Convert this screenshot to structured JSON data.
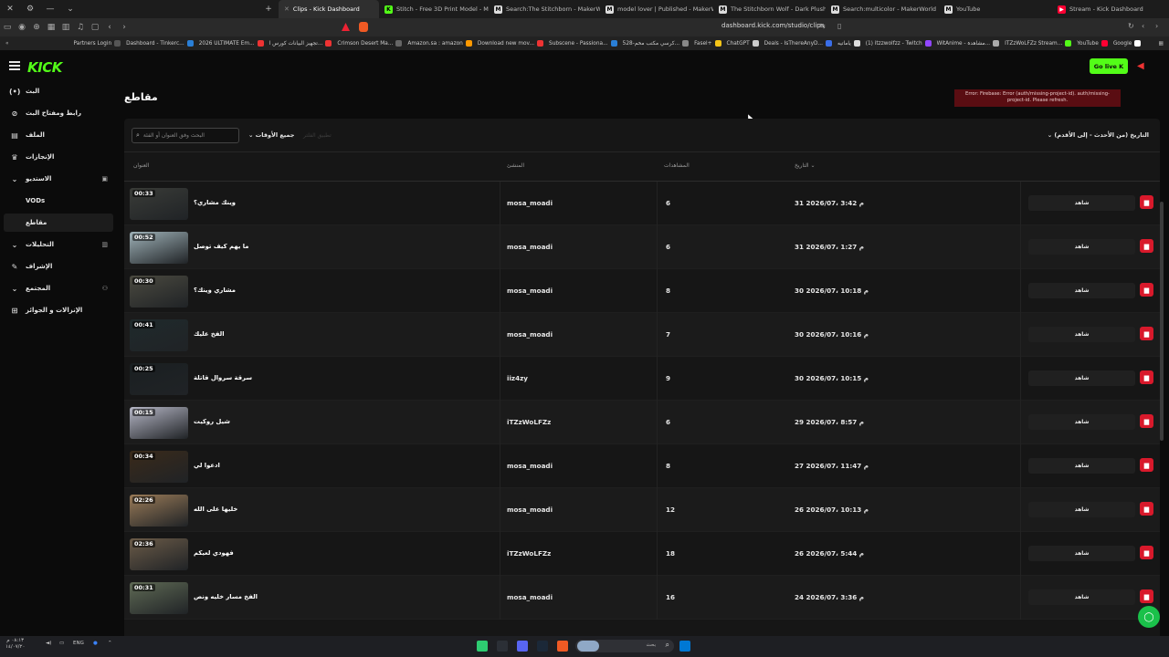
{
  "browser": {
    "tabs": [
      {
        "label": "Clips - Kick Dashboard",
        "icon": "kick-icon",
        "color": "#53fc18",
        "active": true
      },
      {
        "label": "Stitch - Free 3D Print Model - Maker",
        "icon": "makerworld-icon",
        "color": "#e6e6e6"
      },
      {
        "label": "Search:The Stitchborn - MakerWorld",
        "icon": "makerworld-icon",
        "color": "#e6e6e6"
      },
      {
        "label": "model lover | Published - MakerWorld",
        "icon": "makerworld-icon",
        "color": "#e6e6e6"
      },
      {
        "label": "The Stitchborn Wolf - Dark Plush Gu",
        "icon": "makerworld-icon",
        "color": "#e6e6e6"
      },
      {
        "label": "Search:multicolor - MakerWorld",
        "icon": "makerworld-icon",
        "color": "#e6e6e6"
      },
      {
        "label": "YouTube",
        "icon": "youtube-icon",
        "color": "#ff0033"
      },
      {
        "label": "Stream - Kick Dashboard",
        "icon": "kick-icon",
        "color": "#53fc18"
      }
    ],
    "url": "dashboard.kick.com/studio/clips",
    "bookmarks": [
      {
        "label": "Partners Login"
      },
      {
        "label": "Dashboard - Tinkerc..."
      },
      {
        "label": "2026 ULTIMATE Em..."
      },
      {
        "label": "تجهيز البيانات كورس ا..."
      },
      {
        "label": "Crimson Desert Ma..."
      },
      {
        "label": "Amazon.sa : amazon"
      },
      {
        "label": "Download new mov..."
      },
      {
        "label": "Subscene - Passiona..."
      },
      {
        "label": "528-كرسي مكتب مخم..."
      },
      {
        "label": "Fasel+"
      },
      {
        "label": "ChatGPT"
      },
      {
        "label": "Deals - IsThereAnyD..."
      },
      {
        "label": "ياماتيه"
      },
      {
        "label": "(1) itzzwolfzz - Twitch"
      },
      {
        "label": "WitAnime - مشاهدة..."
      },
      {
        "label": "ITZzWoLFZz Stream..."
      },
      {
        "label": "YouTube"
      },
      {
        "label": "Google"
      }
    ]
  },
  "header": {
    "logo": "KICK",
    "go_live": "Go live"
  },
  "sidebar": {
    "items": [
      {
        "label": "البث",
        "icon": "(•)"
      },
      {
        "label": "رابط ومفتاح البث",
        "icon": "🔗"
      },
      {
        "label": "الملف",
        "icon": "▤"
      },
      {
        "label": "الإنجازات",
        "icon": "🏆"
      },
      {
        "label": "الاستديو",
        "icon": "▣",
        "expanded": true
      },
      {
        "label": "VODs",
        "sub": true
      },
      {
        "label": "مقاطع",
        "sub": true,
        "selected": true
      },
      {
        "label": "التحليلات",
        "icon": "⌄"
      },
      {
        "label": "الإشراف",
        "icon": "🔧"
      },
      {
        "label": "المجتمع",
        "icon": "⌄"
      },
      {
        "label": "الإنزالات و الجوائز",
        "icon": "🎁"
      }
    ]
  },
  "page": {
    "title": "مقاطع",
    "error": "Error: Firebase: Error (auth/missing-project-id). auth/missing-project-id. Please refresh."
  },
  "filters": {
    "search_placeholder": "البحث وفق العنوان أو الفئة",
    "time_filter": "جميع الأوقات",
    "faded_label": "تطبيق الفلتر",
    "sort": "التاريخ (من الأحدث - إلى الأقدم)"
  },
  "table": {
    "headers": {
      "title": "العنوان",
      "creator": "المنشئ",
      "views": "المشاهدات",
      "date": "التاريخ"
    },
    "watch_label": "شاهد",
    "rows": [
      {
        "duration": "00:33",
        "title": "وينك مشاري؟",
        "creator": "mosa_moadi",
        "views": "6",
        "date": "31 2026/07، 3:42 م",
        "thumb": "#3a3c38"
      },
      {
        "duration": "00:52",
        "title": "ما يهم كيف توصل",
        "creator": "mosa_moadi",
        "views": "6",
        "date": "31 2026/07، 1:27 م",
        "thumb": "#9fb2b8"
      },
      {
        "duration": "00:30",
        "title": "مشاري وينك؟",
        "creator": "mosa_moadi",
        "views": "8",
        "date": "30 2026/07، 10:18 م",
        "thumb": "#4b4a40"
      },
      {
        "duration": "00:41",
        "title": "الفخ عليك",
        "creator": "mosa_moadi",
        "views": "7",
        "date": "30 2026/07، 10:16 م",
        "thumb": "#1f2a2c"
      },
      {
        "duration": "00:25",
        "title": "سرقة سروال قاتلة",
        "creator": "iiz4zy",
        "views": "9",
        "date": "30 2026/07، 10:15 م",
        "thumb": "#1a1f21"
      },
      {
        "duration": "00:15",
        "title": "شيل روكيت",
        "creator": "iTZzWoLFZz",
        "views": "6",
        "date": "29 2026/07، 8:57 م",
        "thumb": "#b6b7c6"
      },
      {
        "duration": "00:34",
        "title": "ادعوا لي",
        "creator": "mosa_moadi",
        "views": "8",
        "date": "27 2026/07، 11:47 م",
        "thumb": "#3a2a1a"
      },
      {
        "duration": "02:26",
        "title": "خليها على الله",
        "creator": "mosa_moadi",
        "views": "12",
        "date": "26 2026/07، 10:13 م",
        "thumb": "#9a7b58"
      },
      {
        "duration": "02:36",
        "title": "فهودي لعيكم",
        "creator": "iTZzWoLFZz",
        "views": "18",
        "date": "26 2026/07، 5:44 م",
        "thumb": "#6b5b48"
      },
      {
        "duration": "00:31",
        "title": "الفخ مسار خليه ونص",
        "creator": "mosa_moadi",
        "views": "16",
        "date": "24 2026/07، 3:36 م",
        "thumb": "#5f6a55"
      }
    ]
  },
  "taskbar": {
    "time": "٠٨:١٣ م",
    "date": "١٤/٠٧/٢٠",
    "lang": "ENG",
    "search_placeholder": "بحث"
  },
  "colors": {
    "accent": "#53fc18",
    "danger": "#d8192b",
    "background": "#0b0b0b",
    "panel": "#161616"
  }
}
